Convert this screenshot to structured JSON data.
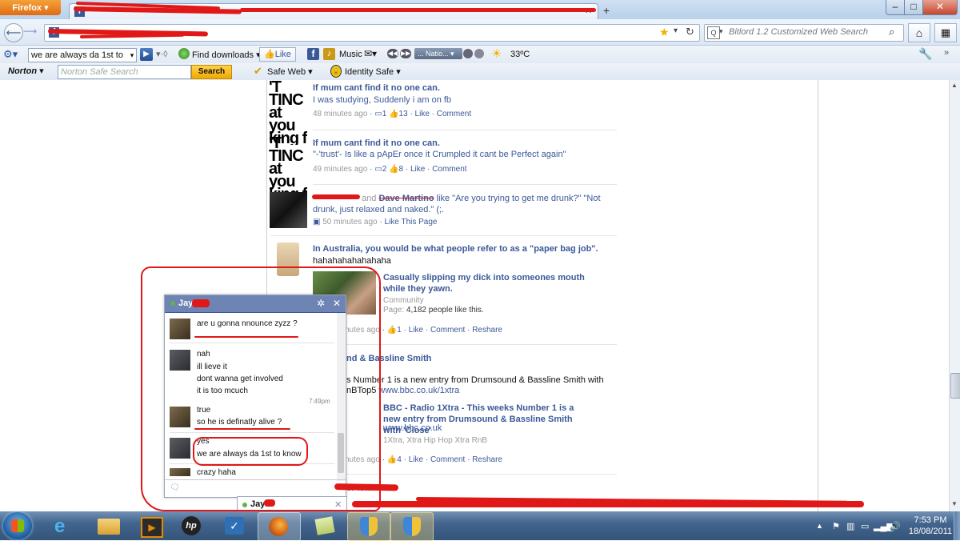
{
  "browser": {
    "menu_button": "Firefox",
    "new_tab": "+",
    "window_controls": {
      "minimize": "–",
      "maximize": "□",
      "close": "✕"
    },
    "search_placeholder": "Bitlord 1.2 Customized Web Search",
    "home_icon": "home-icon"
  },
  "toolbar1": {
    "search_value": "we are always da 1st to",
    "find_downloads": "Find downloads",
    "like": "Like",
    "music": "Music",
    "radio": "... Natio...",
    "temperature": "33ºC"
  },
  "toolbar2": {
    "norton": "Norton",
    "norton_placeholder": "Norton Safe Search",
    "search_button": "Search",
    "safe_web": "Safe Web",
    "identity_safe": "Identity Safe"
  },
  "feed": {
    "post1": {
      "thumb": [
        "'T TINC",
        "at you",
        "king f"
      ],
      "title": "If mum cant find it no one can.",
      "text": "I was studying, Suddenly i am on fb",
      "time": "48 minutes ago",
      "comments": "1",
      "likes": "13",
      "actions": "· Like · Comment"
    },
    "post2": {
      "thumb": [
        "'T TINC",
        "at you",
        "king f"
      ],
      "title": "If mum cant find it no one can.",
      "text": "\"-'trust'- Is like a pApEr once it Crumpled it cant be Perfect again\"",
      "time": "49 minutes ago",
      "comments": "2",
      "likes": "8",
      "actions": "· Like · Comment"
    },
    "post3": {
      "and": "and",
      "person": "Dave Martino",
      "text1": "like \"Are you trying to get me drunk?\" \"Not",
      "text2": "drunk, just relaxed and naked.\" (;.",
      "time": "50 minutes ago",
      "actions": "· Like This Page"
    },
    "post4": {
      "title": "In Australia, you would be what people refer to as a \"paper bag job\".",
      "text": "hahahahahahahaha",
      "link_title": "Casually slipping my dick into someones mouth while they yawn.",
      "link_type": "Community",
      "link_page_label": "Page:",
      "link_page_value": "4,182 people like this.",
      "time": "nutes ago",
      "likes": "1",
      "actions": "· Like · Comment · Reshare"
    },
    "post5": {
      "title": "nd & Bassline Smith",
      "text1": "s Number 1 is a new entry from Drumsound & Bassline Smith with",
      "text2": "nBTop5",
      "url": "www.bbc.co.uk/1xtra",
      "link_title": "BBC - Radio 1Xtra - This weeks Number 1 is a new entry from Drumsound & Bassline Smith with 'Close'",
      "link_url": "www.bbc.co.uk",
      "link_desc": "1Xtra, Xtra Hip Hop Xtra RnB",
      "time": "nutes ago",
      "likes": "4",
      "actions": "· Like · Comment · Reshare"
    },
    "post6": {
      "title": "er Istu"
    }
  },
  "chat": {
    "name": "Jay",
    "messages": [
      {
        "lines": [
          "are u gonna nnounce zyzz ?"
        ]
      },
      {
        "lines": [
          "nah",
          "ill lieve it",
          "dont wanna get involved",
          "it is too mcuch"
        ]
      },
      {
        "time": "7:49pm"
      },
      {
        "lines": [
          "true",
          "so he is definatly alive ?"
        ]
      },
      {
        "lines": [
          "yes",
          "we are always da 1st to know"
        ]
      },
      {
        "lines": [
          "crazy haha"
        ]
      }
    ],
    "bar_name": "Jay"
  },
  "taskbar": {
    "time": "7:53 PM",
    "date": "18/08/2011"
  },
  "colors": {
    "fb_blue": "#3b5998",
    "chat_header": "#6d84b4",
    "annotation_red": "#e01818",
    "firefox_orange": "#e8751a"
  }
}
